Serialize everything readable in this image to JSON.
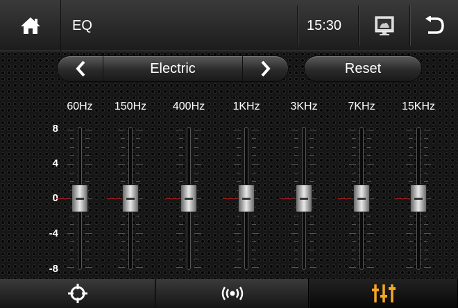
{
  "header": {
    "title": "EQ",
    "time": "15:30"
  },
  "preset": {
    "name": "Electric",
    "reset_label": "Reset"
  },
  "bands": [
    {
      "label": "60Hz",
      "value": 0
    },
    {
      "label": "150Hz",
      "value": 0
    },
    {
      "label": "400Hz",
      "value": 0
    },
    {
      "label": "1KHz",
      "value": 0
    },
    {
      "label": "3KHz",
      "value": 0
    },
    {
      "label": "7KHz",
      "value": 0
    },
    {
      "label": "15KHz",
      "value": 0
    }
  ],
  "scale": [
    "8",
    "4",
    "0",
    "-4",
    "-8"
  ],
  "gain_range": [
    -8,
    8
  ],
  "bottom_tabs": [
    {
      "icon": "crosshair-icon",
      "active": false
    },
    {
      "icon": "radio-signal-icon",
      "active": false
    },
    {
      "icon": "equalizer-icon",
      "active": true
    }
  ],
  "colors": {
    "accent": "#f5a623",
    "zero_line": "#b52020"
  }
}
